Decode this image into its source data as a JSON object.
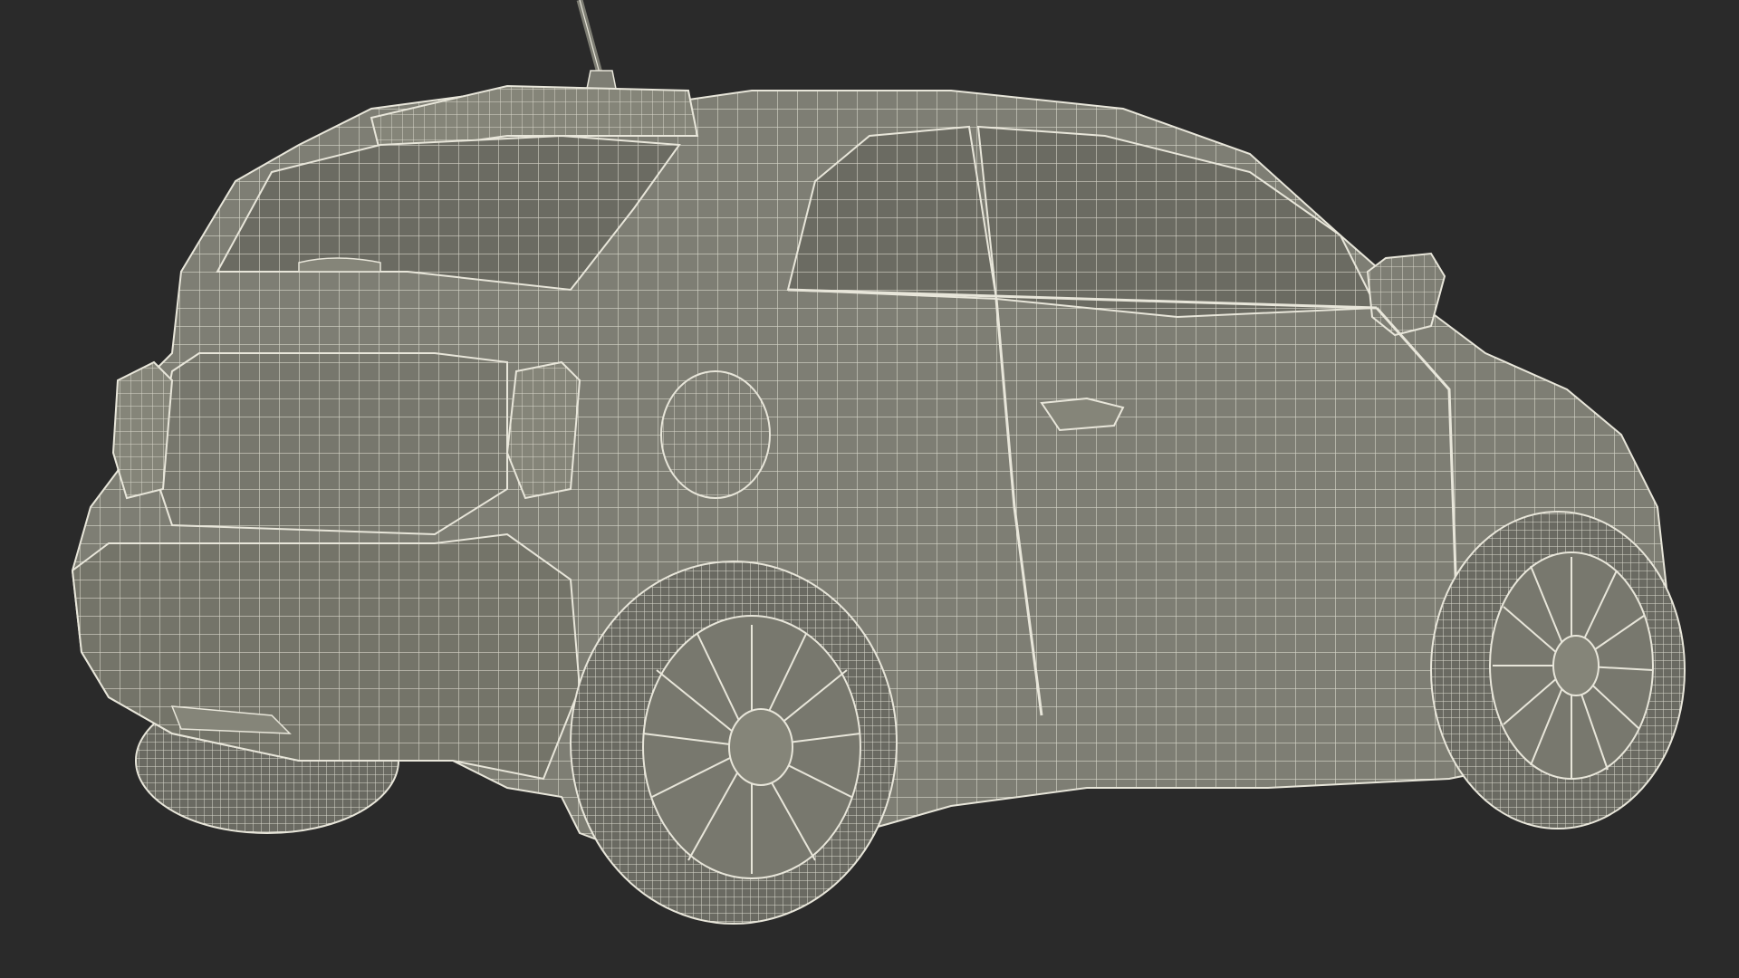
{
  "scene": {
    "subject_icon": "car-icon",
    "colors": {
      "background": "#2a2a2a",
      "body_fill": "#7e7e74",
      "body_shadow": "#5f5f57",
      "window_fill": "#6b6b62",
      "tire_fill": "#6a6a62",
      "wire": "#e8e6da"
    }
  }
}
